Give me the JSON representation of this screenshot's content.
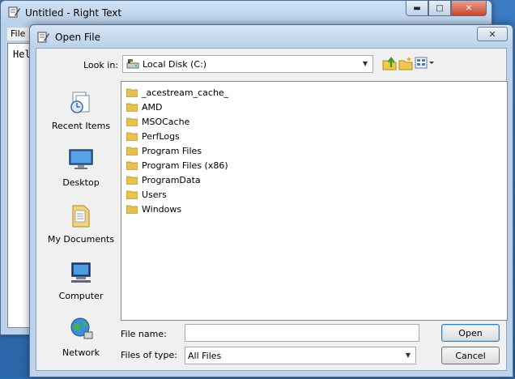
{
  "background_window": {
    "title": "Untitled - Right Text",
    "menu_file": "File",
    "editor_text": "Hel",
    "controls": {
      "minimize": "▬",
      "maximize": "□",
      "close": "✕"
    }
  },
  "dialog": {
    "title": "Open File",
    "close_label": "✕",
    "look_in_label": "Look in:",
    "look_in_value": "Local Disk (C:)",
    "toolbar": {
      "up_icon": "folder-up-icon",
      "new_folder_icon": "new-folder-icon",
      "view_menu_icon": "view-menu-icon"
    },
    "places": [
      {
        "label": "Recent Items",
        "icon": "recent-items-icon"
      },
      {
        "label": "Desktop",
        "icon": "desktop-icon"
      },
      {
        "label": "My Documents",
        "icon": "documents-icon"
      },
      {
        "label": "Computer",
        "icon": "computer-icon"
      },
      {
        "label": "Network",
        "icon": "network-icon"
      }
    ],
    "files": [
      "_acestream_cache_",
      "AMD",
      "MSOCache",
      "PerfLogs",
      "Program Files",
      "Program Files (x86)",
      "ProgramData",
      "Users",
      "Windows"
    ],
    "file_name_label": "File name:",
    "file_name_value": "",
    "file_type_label": "Files of type:",
    "file_type_value": "All Files",
    "open_button": "Open",
    "cancel_button": "Cancel"
  },
  "colors": {
    "desktop": "#2a66a8",
    "titlebar": "#bcd2ea",
    "folder": "#e8c250",
    "accent": "#3c7fb1"
  }
}
